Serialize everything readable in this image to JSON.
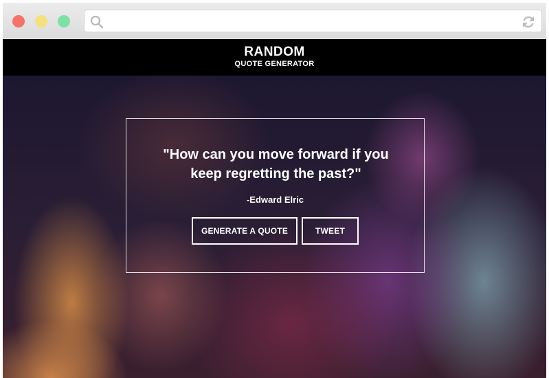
{
  "browser": {
    "url_value": "",
    "icons": {
      "search": "search-icon",
      "refresh": "refresh-icon"
    }
  },
  "header": {
    "title": "RANDOM",
    "subtitle": "QUOTE GENERATOR"
  },
  "quote": {
    "text": "\"How can you move forward if you keep regretting the past?\"",
    "author": "-Edward Elric"
  },
  "buttons": {
    "generate_label": "GENERATE A QUOTE",
    "tweet_label": "TWEET"
  },
  "colors": {
    "navbar": "#000000",
    "text": "#ffffff",
    "close_dot": "#f4736b",
    "minimize_dot": "#f6e07e",
    "maximize_dot": "#7fe0a5"
  }
}
